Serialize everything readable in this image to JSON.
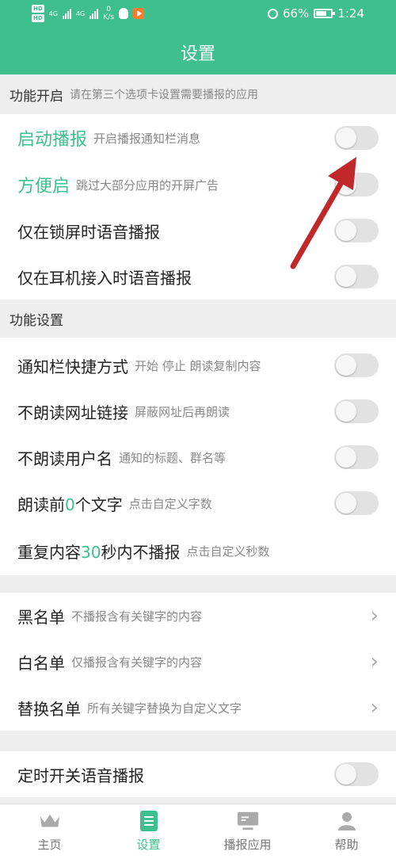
{
  "status_bar": {
    "hd1": "HD",
    "hd2": "HD",
    "net1": "4G",
    "net2": "4G",
    "speed_value": "0",
    "speed_unit": "K/s",
    "battery": "66%",
    "time": "1:24"
  },
  "header": {
    "title": "设置"
  },
  "section1": {
    "title": "功能开启",
    "subtitle": "请在第三个选项卡设置需要播报的应用",
    "rows": [
      {
        "label": "启动播报",
        "sub": "开启播报通知栏消息",
        "on": false
      },
      {
        "label": "方便启",
        "sub": "跳过大部分应用的开屏广告",
        "on": false
      },
      {
        "label": "仅在锁屏时语音播报",
        "on": false
      },
      {
        "label": "仅在耳机接入时语音播报",
        "on": false
      }
    ]
  },
  "section2": {
    "title": "功能设置",
    "rows": [
      {
        "label": "通知栏快捷方式",
        "sub": "开始 停止 朗读复制内容",
        "on": false
      },
      {
        "label": "不朗读网址链接",
        "sub": "屏蔽网址后再朗读",
        "on": false
      },
      {
        "label": "不朗读用户名",
        "sub": "通知的标题、群名等",
        "on": false
      },
      {
        "label_pre": "朗读前",
        "label_num": "0",
        "label_post": "个文字",
        "sub": "点击自定义字数",
        "on": false
      },
      {
        "label_pre": "重复内容",
        "label_num": "30",
        "label_post": "秒内不播报",
        "sub": "点击自定义秒数"
      }
    ]
  },
  "section3": {
    "rows": [
      {
        "label": "黑名单",
        "sub": "不播报含有关键字的内容"
      },
      {
        "label": "白名单",
        "sub": "仅播报含有关键字的内容"
      },
      {
        "label": "替换名单",
        "sub": "所有关键字替换为自定义文字"
      }
    ]
  },
  "section4": {
    "rows": [
      {
        "label": "定时开关语音播报",
        "on": false
      }
    ]
  },
  "bottom_nav": {
    "items": [
      {
        "label": "主页",
        "icon": "crown-icon"
      },
      {
        "label": "设置",
        "icon": "settings-doc-icon",
        "active": true
      },
      {
        "label": "播报应用",
        "icon": "monitor-icon"
      },
      {
        "label": "帮助",
        "icon": "person-icon"
      }
    ]
  },
  "colors": {
    "accent": "#3fbf8e",
    "arrow": "#c0282a"
  }
}
